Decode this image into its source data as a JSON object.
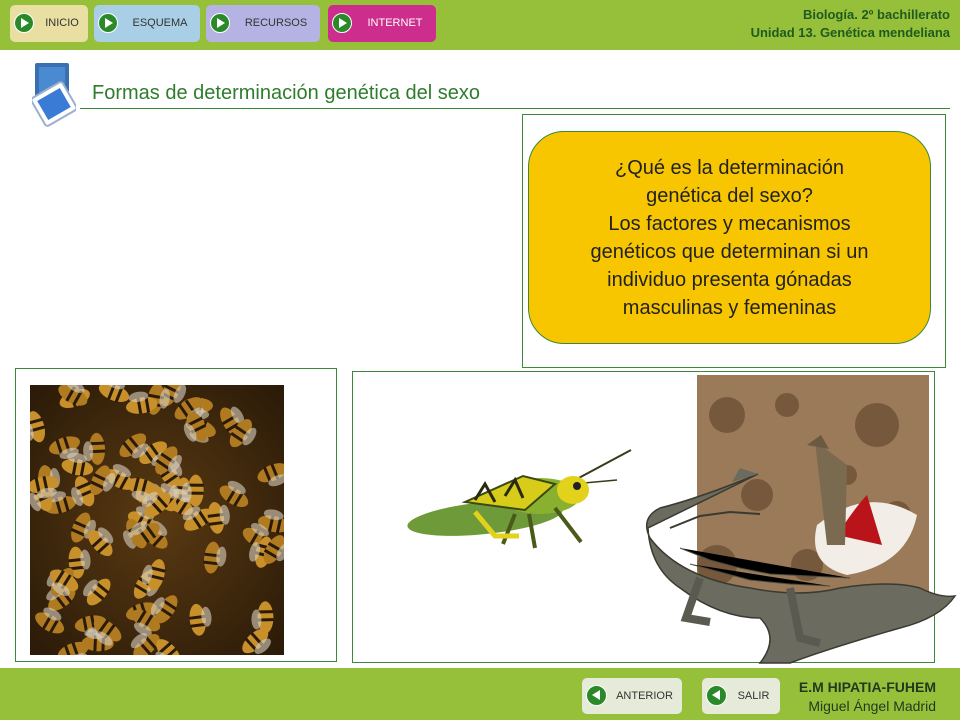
{
  "nav": {
    "items": [
      {
        "label": "INICIO",
        "color": "#e9dfa3"
      },
      {
        "label": "ESQUEMA",
        "color": "#a9cfe7"
      },
      {
        "label": "RECURSOS",
        "color": "#b5b3e4"
      },
      {
        "label": "INTERNET",
        "color": "#cd2e8e"
      }
    ]
  },
  "header": {
    "course": "Biología. 2º bachillerato",
    "unit": "Unidad 13. Genética mendeliana"
  },
  "page": {
    "title": "Formas de determinación genética del sexo"
  },
  "callout": {
    "lines": [
      "¿Qué es la determinación",
      "genética del sexo?",
      "Los factores y mecanismos",
      "genéticos que determinan si un",
      "individuo presenta gónadas",
      "masculinas y femeninas"
    ],
    "background": "#f7c600"
  },
  "images": [
    {
      "name": "bees-photo",
      "description_icon": "bees-icon"
    },
    {
      "name": "grasshopper-photo",
      "description_icon": "grasshopper-icon"
    },
    {
      "name": "crocodile-photo",
      "description_icon": "crocodile-icon"
    }
  ],
  "footer": {
    "prev_label": "ANTERIOR",
    "exit_label": "SALIR",
    "school": "E.M HIPATIA-FUHEM",
    "author": "Miguel Ángel Madrid"
  },
  "colors": {
    "bar": "#97c03a",
    "accent_green": "#2e7d2e",
    "frame_border": "#3a8a3a"
  }
}
